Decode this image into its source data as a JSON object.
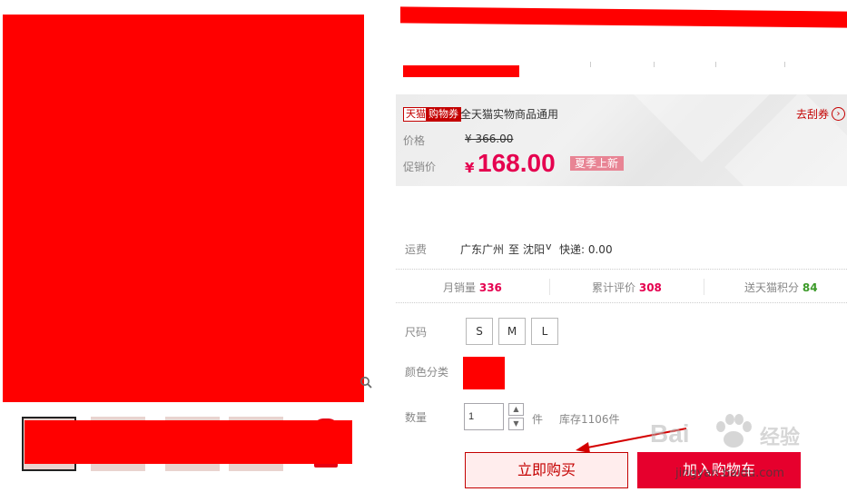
{
  "coupon": {
    "tag_brand": "天猫",
    "tag_type": "购物券",
    "text": "全天猫实物商品通用",
    "link": "去刮券",
    "arrow": "›"
  },
  "price": {
    "label": "价格",
    "original": "¥ 366.00"
  },
  "promo": {
    "label": "促销价",
    "currency": "¥",
    "value": "168.00",
    "badge": "夏季上新"
  },
  "shipping": {
    "label": "运费",
    "from": "广东广州",
    "to_word": "至",
    "city": "沈阳",
    "chevron": "v",
    "fee": "快递: 0.00"
  },
  "stats": {
    "monthly_sales_label": "月销量",
    "monthly_sales_value": "336",
    "reviews_label": "累计评价",
    "reviews_value": "308",
    "points_label": "送天猫积分",
    "points_value": "84"
  },
  "options": {
    "size_label": "尺码",
    "sizes": [
      "S",
      "M",
      "L"
    ],
    "color_label": "颜色分类"
  },
  "quantity": {
    "label": "数量",
    "value": "1",
    "unit": "件",
    "stock": "库存1106件",
    "up": "▲",
    "down": "▼"
  },
  "actions": {
    "buy_now": "立即购买",
    "add_to_cart": "加入购物车"
  },
  "watermark": {
    "brand_a": "Bai",
    "brand_b": "经验",
    "url": "jingyan.baidu.com"
  },
  "colors": {
    "accent_red": "#e5004f",
    "tmall_red": "#c40000",
    "redaction": "#ff0000",
    "cart_button": "#e6002d",
    "points_green": "#3c9a29"
  },
  "icons": {
    "zoom": "magnifier-icon",
    "coupon_arrow": "chevron-right-icon"
  }
}
